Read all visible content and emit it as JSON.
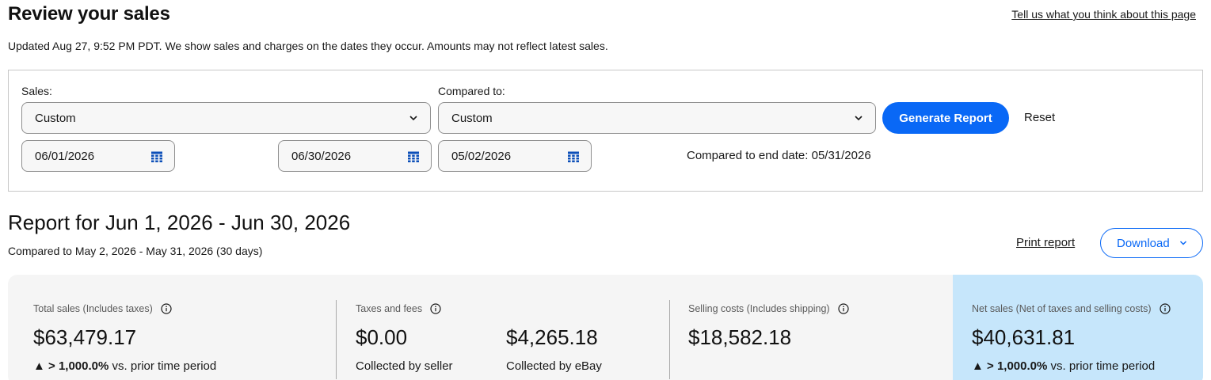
{
  "header": {
    "title": "Review your sales",
    "feedback_link": "Tell us what you think about this page",
    "updated_text": "Updated Aug 27, 9:52 PM PDT. We show sales and charges on the dates they occur. Amounts may not reflect latest sales."
  },
  "filters": {
    "sales_label": "Sales:",
    "sales_select": "Custom",
    "compared_label": "Compared to:",
    "compared_select": "Custom",
    "sales_start": "06/01/2026",
    "sales_end": "06/30/2026",
    "compared_start": "05/02/2026",
    "compared_end_text": "Compared to end date: 05/31/2026",
    "generate_label": "Generate Report",
    "reset_label": "Reset"
  },
  "report": {
    "title": "Report for Jun 1, 2026 - Jun 30, 2026",
    "subtitle": "Compared to May 2, 2026 - May 31, 2026 (30 days)",
    "print_label": "Print report",
    "download_label": "Download"
  },
  "summary": {
    "total_sales": {
      "label": "Total sales (Includes taxes)",
      "value": "$63,479.17",
      "change": "> 1,000.0%",
      "change_suffix": "vs. prior time period"
    },
    "taxes_fees": {
      "label": "Taxes and fees",
      "seller_value": "$0.00",
      "seller_caption": "Collected by seller",
      "ebay_value": "$4,265.18",
      "ebay_caption": "Collected by eBay"
    },
    "selling_costs": {
      "label": "Selling costs (Includes shipping)",
      "value": "$18,582.18"
    },
    "net_sales": {
      "label": "Net sales (Net of taxes and selling costs)",
      "value": "$40,631.81",
      "change": "> 1,000.0%",
      "change_suffix": "vs. prior time period"
    }
  },
  "colors": {
    "primary_blue": "#0968f6",
    "net_panel": "#c6e6fb",
    "summary_bg": "#f5f5f5"
  }
}
